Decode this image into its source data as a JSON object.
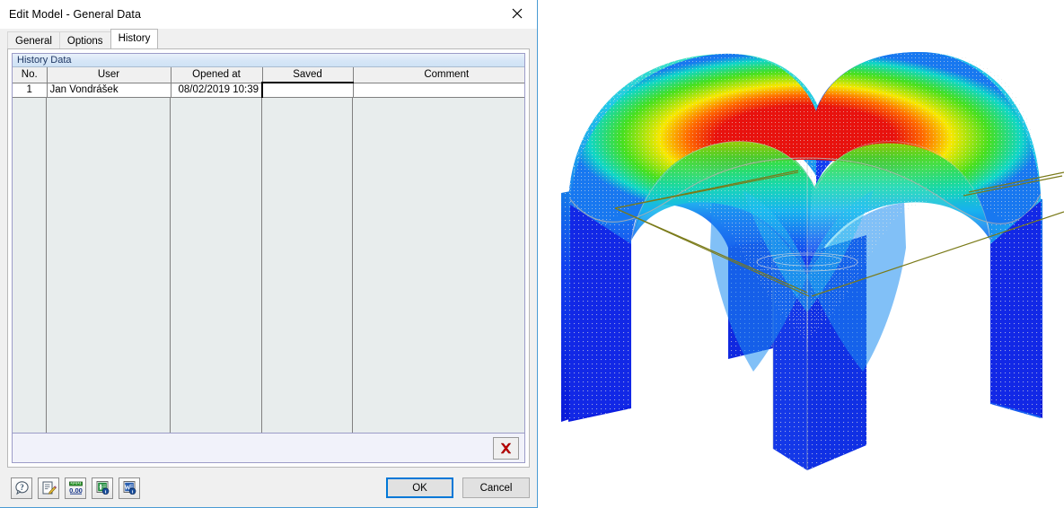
{
  "window": {
    "title": "Edit Model - General Data",
    "close_icon": "close-icon"
  },
  "tabs": [
    {
      "label": "General",
      "active": false
    },
    {
      "label": "Options",
      "active": false
    },
    {
      "label": "History",
      "active": true
    }
  ],
  "panel": {
    "section_title": "History Data",
    "table": {
      "columns": [
        "No.",
        "User",
        "Opened at",
        "Saved",
        "Comment"
      ],
      "rows": [
        {
          "no": "1",
          "user": "Jan Vondrášek",
          "opened_at": "08/02/2019 10:39",
          "saved": "",
          "comment": ""
        }
      ]
    },
    "delete_button": {
      "tooltip": "Delete",
      "icon": "red-x-delete-icon"
    }
  },
  "toolbar": [
    {
      "name": "help-button",
      "icon": "question-help-icon"
    },
    {
      "name": "edit-comment-button",
      "icon": "pencil-notepad-icon"
    },
    {
      "name": "units-button",
      "icon": "units-ruler-icon"
    },
    {
      "name": "export-excel-button",
      "icon": "excel-export-icon"
    },
    {
      "name": "export-word-button",
      "icon": "word-export-icon"
    }
  ],
  "actions": {
    "ok_label": "OK",
    "cancel_label": "Cancel"
  },
  "viewport": {
    "model_name": "groin-vault-fem-model",
    "colors": {
      "peak": "#e8120e",
      "high": "#f7e800",
      "mid": "#14d81a",
      "low": "#18d8e0",
      "base": "#1030f0",
      "outline": "#7a7a18",
      "mesh": "#c8c8c8"
    }
  }
}
